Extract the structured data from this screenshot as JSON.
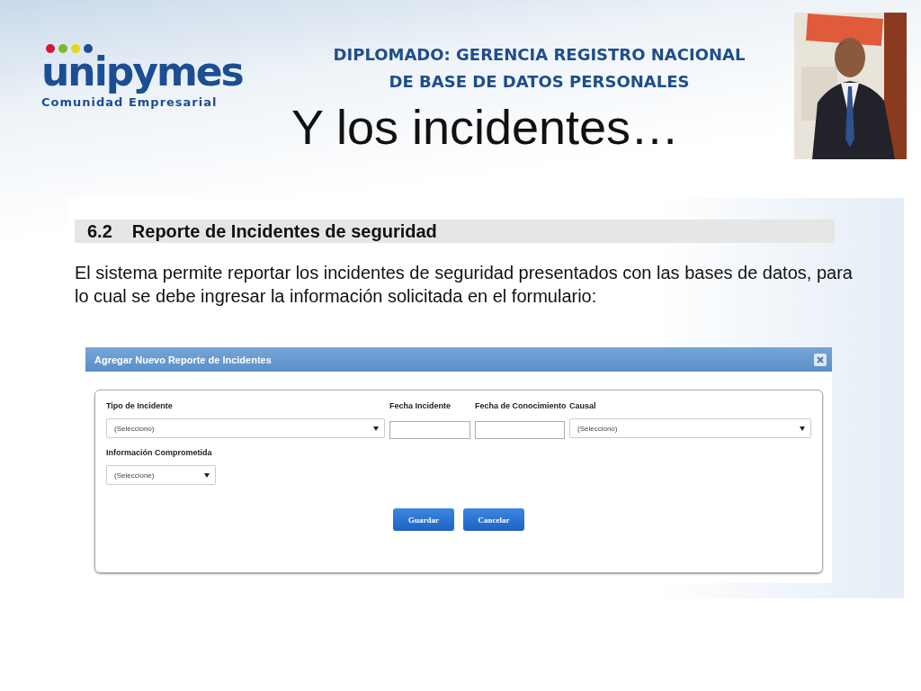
{
  "logo": {
    "name": "unipymes",
    "tagline": "Comunidad Empresarial"
  },
  "header": {
    "lines": [
      "DIPLOMADO: GERENCIA REGISTRO NACIONAL",
      "DE BASE DE DATOS PERSONALES"
    ]
  },
  "title": "Y los incidentes…",
  "document": {
    "section_number": "6.2",
    "section_title": "Reporte de Incidentes de seguridad",
    "paragraph": "El sistema permite reportar los incidentes de seguridad presentados con las bases de datos, para lo cual se debe ingresar la información solicitada en el formulario:",
    "dialog": {
      "title": "Agregar Nuevo Reporte de Incidentes",
      "rows": [
        {
          "fields": [
            {
              "kind": "select",
              "label": "Tipo de Incidente",
              "value": "(Selecciono)"
            },
            {
              "kind": "text",
              "label": "Fecha Incidente"
            },
            {
              "kind": "text",
              "label": "Fecha de Conocimiento"
            },
            {
              "kind": "select",
              "label": "Causal",
              "value": "(Selecciono)"
            }
          ]
        },
        {
          "fields": [
            {
              "kind": "select",
              "label": "Información Comprometida",
              "value": "(Seleccione)"
            }
          ]
        }
      ],
      "buttons": [
        "Guardar",
        "Cancelar"
      ]
    }
  }
}
